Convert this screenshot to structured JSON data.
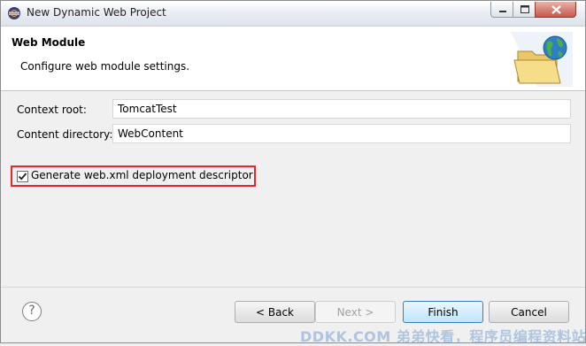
{
  "window": {
    "title": "New Dynamic Web Project",
    "icons": {
      "app": "eclipse-app-icon",
      "minimize": "minimize-icon",
      "maximize": "maximize-icon",
      "close": "close-icon"
    }
  },
  "banner": {
    "title": "Web Module",
    "description": "Configure web module settings.",
    "icon": "web-folder-globe-icon"
  },
  "form": {
    "context_root": {
      "label": "Context root:",
      "value": "TomcatTest"
    },
    "content_directory": {
      "label": "Content directory:",
      "value": "WebContent"
    },
    "generate_webxml": {
      "label": "Generate web.xml deployment descriptor",
      "checked": true
    }
  },
  "buttons": {
    "help": "?",
    "back": "< Back",
    "next": "Next >",
    "finish": "Finish",
    "cancel": "Cancel"
  },
  "watermark": "DDKK.COM 弟弟快看，程序员编程资料站",
  "colors": {
    "highlight_border": "#e8252b",
    "finish_accent": "#3c7fb1"
  }
}
